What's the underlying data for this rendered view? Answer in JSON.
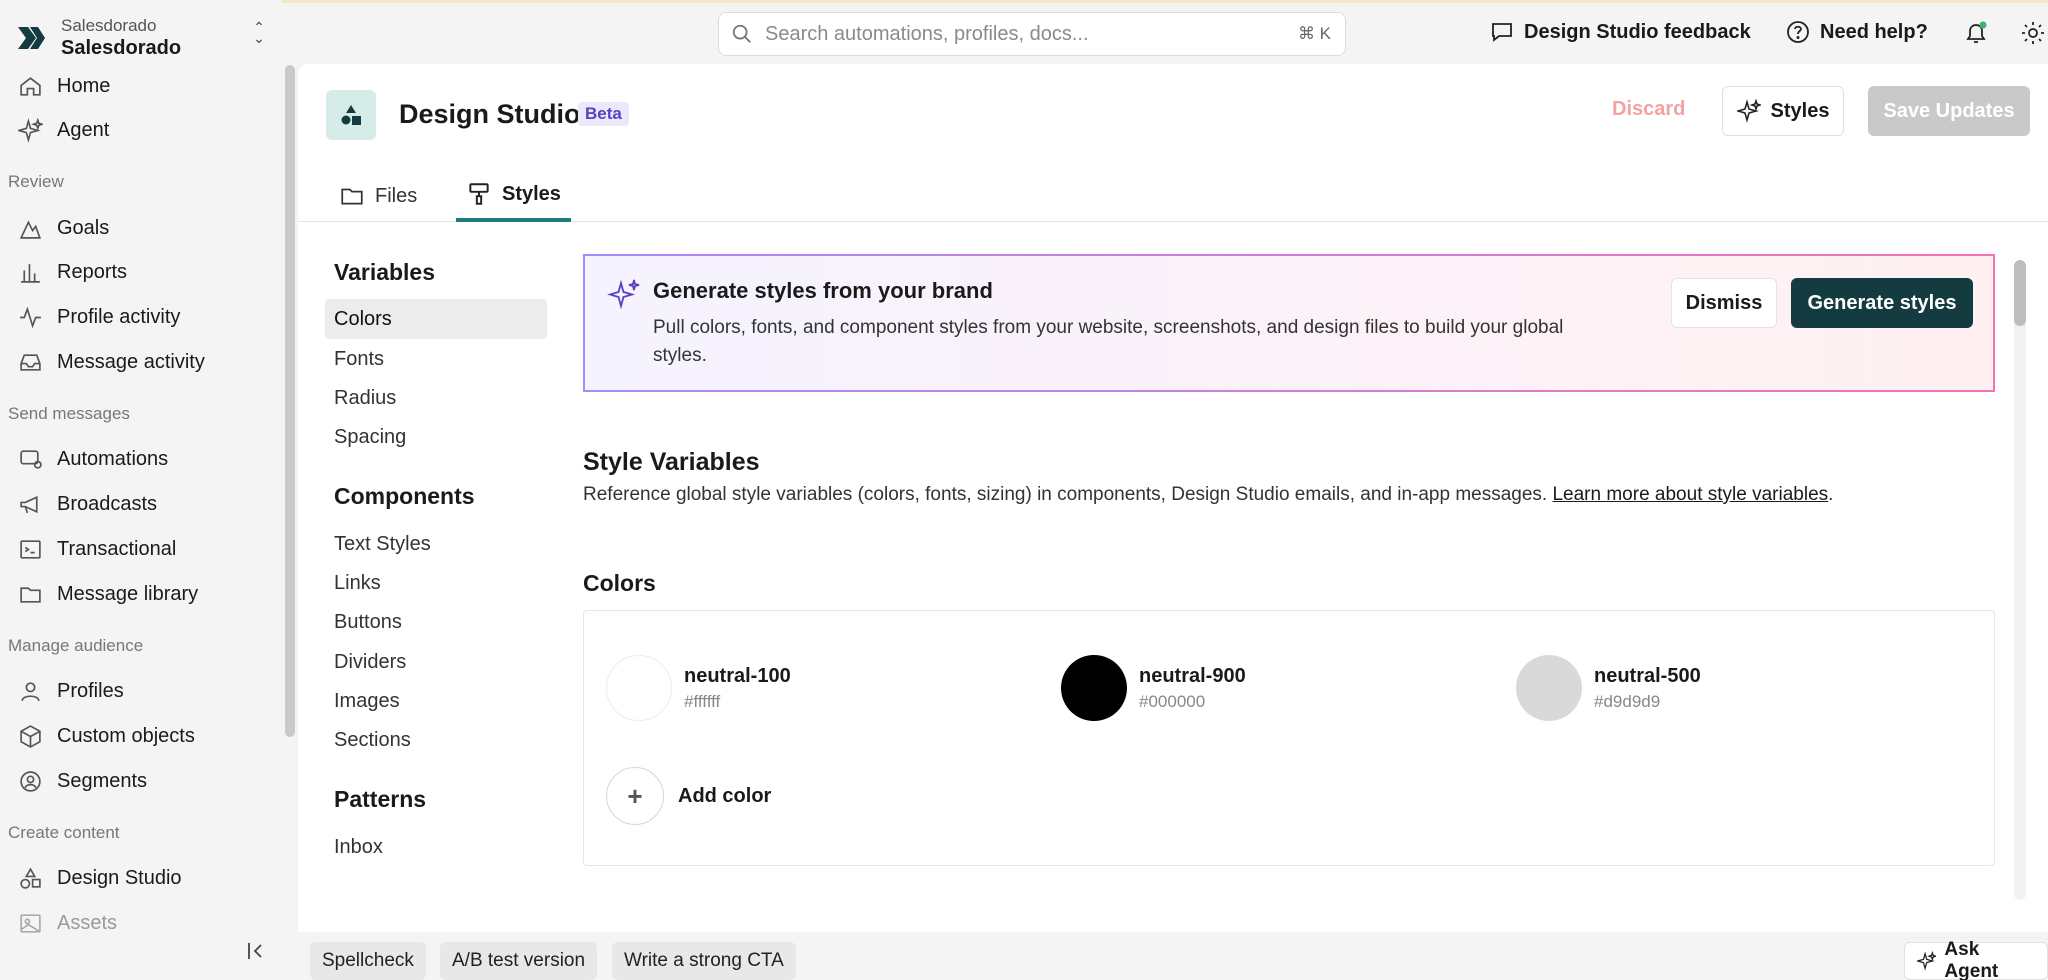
{
  "workspace": {
    "label": "Salesdorado",
    "name": "Salesdorado"
  },
  "sidebar": {
    "top_items": [
      {
        "label": "Home",
        "icon": "home-icon"
      },
      {
        "label": "Agent",
        "icon": "sparkle-icon"
      }
    ],
    "sections": [
      {
        "title": "Review",
        "items": [
          {
            "label": "Goals",
            "icon": "goals-icon"
          },
          {
            "label": "Reports",
            "icon": "bar-chart-icon"
          },
          {
            "label": "Profile activity",
            "icon": "activity-icon"
          },
          {
            "label": "Message activity",
            "icon": "inbox-icon"
          }
        ]
      },
      {
        "title": "Send messages",
        "items": [
          {
            "label": "Automations",
            "icon": "automation-icon"
          },
          {
            "label": "Broadcasts",
            "icon": "megaphone-icon"
          },
          {
            "label": "Transactional",
            "icon": "terminal-icon"
          },
          {
            "label": "Message library",
            "icon": "folder-icon"
          }
        ]
      },
      {
        "title": "Manage audience",
        "items": [
          {
            "label": "Profiles",
            "icon": "user-icon"
          },
          {
            "label": "Custom objects",
            "icon": "cube-icon"
          },
          {
            "label": "Segments",
            "icon": "segment-icon"
          }
        ]
      },
      {
        "title": "Create content",
        "items": [
          {
            "label": "Design Studio",
            "icon": "shapes-icon"
          },
          {
            "label": "Assets",
            "icon": "image-icon"
          }
        ]
      }
    ]
  },
  "header": {
    "search_placeholder": "Search automations, profiles, docs...",
    "search_shortcut": "⌘ K",
    "feedback": "Design Studio feedback",
    "help": "Need help?"
  },
  "page": {
    "title": "Design Studio",
    "badge": "Beta",
    "discard": "Discard",
    "styles_button": "Styles",
    "save": "Save Updates",
    "tabs": [
      {
        "label": "Files"
      },
      {
        "label": "Styles"
      }
    ]
  },
  "style_nav": {
    "variables_heading": "Variables",
    "variables": [
      "Colors",
      "Fonts",
      "Radius",
      "Spacing"
    ],
    "components_heading": "Components",
    "components": [
      "Text Styles",
      "Links",
      "Buttons",
      "Dividers",
      "Images",
      "Sections"
    ],
    "patterns_heading": "Patterns",
    "patterns": [
      "Inbox"
    ]
  },
  "banner": {
    "title": "Generate styles from your brand",
    "description": "Pull colors, fonts, and component styles from your website, screenshots, and design files to build your global styles.",
    "dismiss": "Dismiss",
    "generate": "Generate styles"
  },
  "style_variables": {
    "title": "Style Variables",
    "description": "Reference global style variables (colors, fonts, sizing) in components, Design Studio emails, and in-app messages. ",
    "link": "Learn more about style variables",
    "trailing": "."
  },
  "colors": {
    "title": "Colors",
    "items": [
      {
        "name": "neutral-100",
        "hex": "#ffffff"
      },
      {
        "name": "neutral-900",
        "hex": "#000000"
      },
      {
        "name": "neutral-500",
        "hex": "#d9d9d9"
      }
    ],
    "add_label": "Add color"
  },
  "bottom": {
    "chips": [
      "Spellcheck",
      "A/B test version",
      "Write a strong CTA"
    ],
    "ask_agent": "Ask Agent"
  }
}
